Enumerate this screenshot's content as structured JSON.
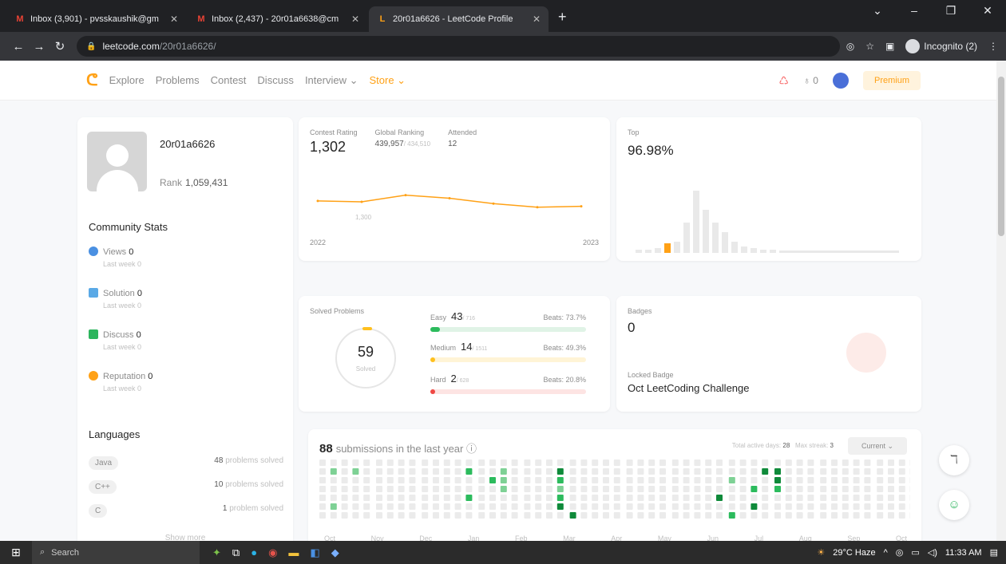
{
  "browser": {
    "tabs": [
      {
        "icon": "M",
        "title": "Inbox (3,901) - pvsskaushik@gm",
        "active": false
      },
      {
        "icon": "M",
        "title": "Inbox (2,437) - 20r01a6638@cm",
        "active": false
      },
      {
        "icon": "L",
        "title": "20r01a6626 - LeetCode Profile",
        "active": true
      }
    ],
    "new_tab": "+",
    "url_host": "leetcode.com",
    "url_path": "/20r01a6626/",
    "incognito": "Incognito (2)"
  },
  "header": {
    "menu": [
      "Explore",
      "Problems",
      "Contest",
      "Discuss",
      "Interview",
      "Store"
    ],
    "coins": "0",
    "premium": "Premium"
  },
  "profile": {
    "username": "20r01a6626",
    "rank_label": "Rank",
    "rank": "1,059,431",
    "community_title": "Community Stats",
    "stats": [
      {
        "label": "Views",
        "value": "0",
        "sub": "Last week 0",
        "color": "#4a90e2"
      },
      {
        "label": "Solution",
        "value": "0",
        "sub": "Last week 0",
        "color": "#5aa9e6"
      },
      {
        "label": "Discuss",
        "value": "0",
        "sub": "Last week 0",
        "color": "#2db55d"
      },
      {
        "label": "Reputation",
        "value": "0",
        "sub": "Last week 0",
        "color": "#ffa116"
      }
    ],
    "languages_title": "Languages",
    "languages": [
      {
        "name": "Java",
        "count": "48",
        "suffix": "problems solved"
      },
      {
        "name": "C++",
        "count": "10",
        "suffix": "problems solved"
      },
      {
        "name": "C",
        "count": "1",
        "suffix": "problem solved"
      }
    ],
    "show_more": "Show more"
  },
  "contest": {
    "rating_label": "Contest Rating",
    "rating": "1,302",
    "global_label": "Global Ranking",
    "global": "439,957",
    "global_total": "/ 434,510",
    "attended_label": "Attended",
    "attended": "12",
    "year_start": "2022",
    "year_end": "2023",
    "point_label": "1,300",
    "top_label": "Top",
    "top_pct": "96.98%"
  },
  "chart_data": {
    "type": "line",
    "x": [
      "2022",
      "2023"
    ],
    "values": [
      1302,
      1300,
      1315,
      1308,
      1296,
      1288,
      1290
    ],
    "ylim": [
      1250,
      1350
    ],
    "xlabel": "",
    "ylabel": ""
  },
  "solved": {
    "title": "Solved Problems",
    "count": "59",
    "count_label": "Solved",
    "rows": [
      {
        "name": "Easy",
        "num": "43",
        "total": "/ 716",
        "beats": "Beats: 73.7%",
        "color": "#2cbb5d",
        "track": "#e0f3e6",
        "fill": 0.06
      },
      {
        "name": "Medium",
        "num": "14",
        "total": "/ 1511",
        "beats": "Beats: 49.3%",
        "color": "#ffc01e",
        "track": "#fff4d6",
        "fill": 0.01
      },
      {
        "name": "Hard",
        "num": "2",
        "total": "/ 628",
        "beats": "Beats: 20.8%",
        "color": "#ef4743",
        "track": "#fde4e3",
        "fill": 0.003
      }
    ]
  },
  "badges": {
    "title": "Badges",
    "count": "0",
    "locked_label": "Locked Badge",
    "badge_name": "Oct LeetCoding Challenge"
  },
  "submissions": {
    "count": "88",
    "text": "submissions in the last year",
    "active_label": "Total active days:",
    "active": "28",
    "streak_label": "Max streak:",
    "streak": "3",
    "select": "Current",
    "months": [
      "Oct",
      "Nov",
      "Dec",
      "Jan",
      "Feb",
      "Mar",
      "Apr",
      "May",
      "Jun",
      "Jul",
      "Aug",
      "Sep",
      "Oct"
    ]
  },
  "taskbar": {
    "search": "Search",
    "weather": "29°C  Haze",
    "time": "11:33 AM"
  }
}
